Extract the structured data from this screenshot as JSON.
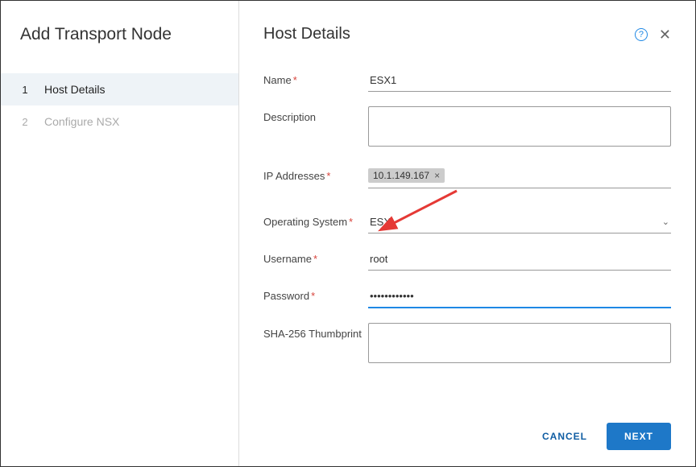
{
  "sidebar": {
    "title": "Add Transport Node",
    "steps": [
      {
        "num": "1",
        "label": "Host Details"
      },
      {
        "num": "2",
        "label": "Configure NSX"
      }
    ]
  },
  "header": {
    "title": "Host Details"
  },
  "form": {
    "name": {
      "label": "Name",
      "value": "ESX1"
    },
    "description": {
      "label": "Description",
      "value": ""
    },
    "ip": {
      "label": "IP Addresses",
      "chip": "10.1.149.167"
    },
    "os": {
      "label": "Operating System",
      "value": "ESXI"
    },
    "username": {
      "label": "Username",
      "value": "root"
    },
    "password": {
      "label": "Password",
      "value": "••••••••••••"
    },
    "thumbprint": {
      "label": "SHA-256 Thumbprint",
      "value": ""
    }
  },
  "footer": {
    "cancel": "CANCEL",
    "next": "NEXT"
  }
}
